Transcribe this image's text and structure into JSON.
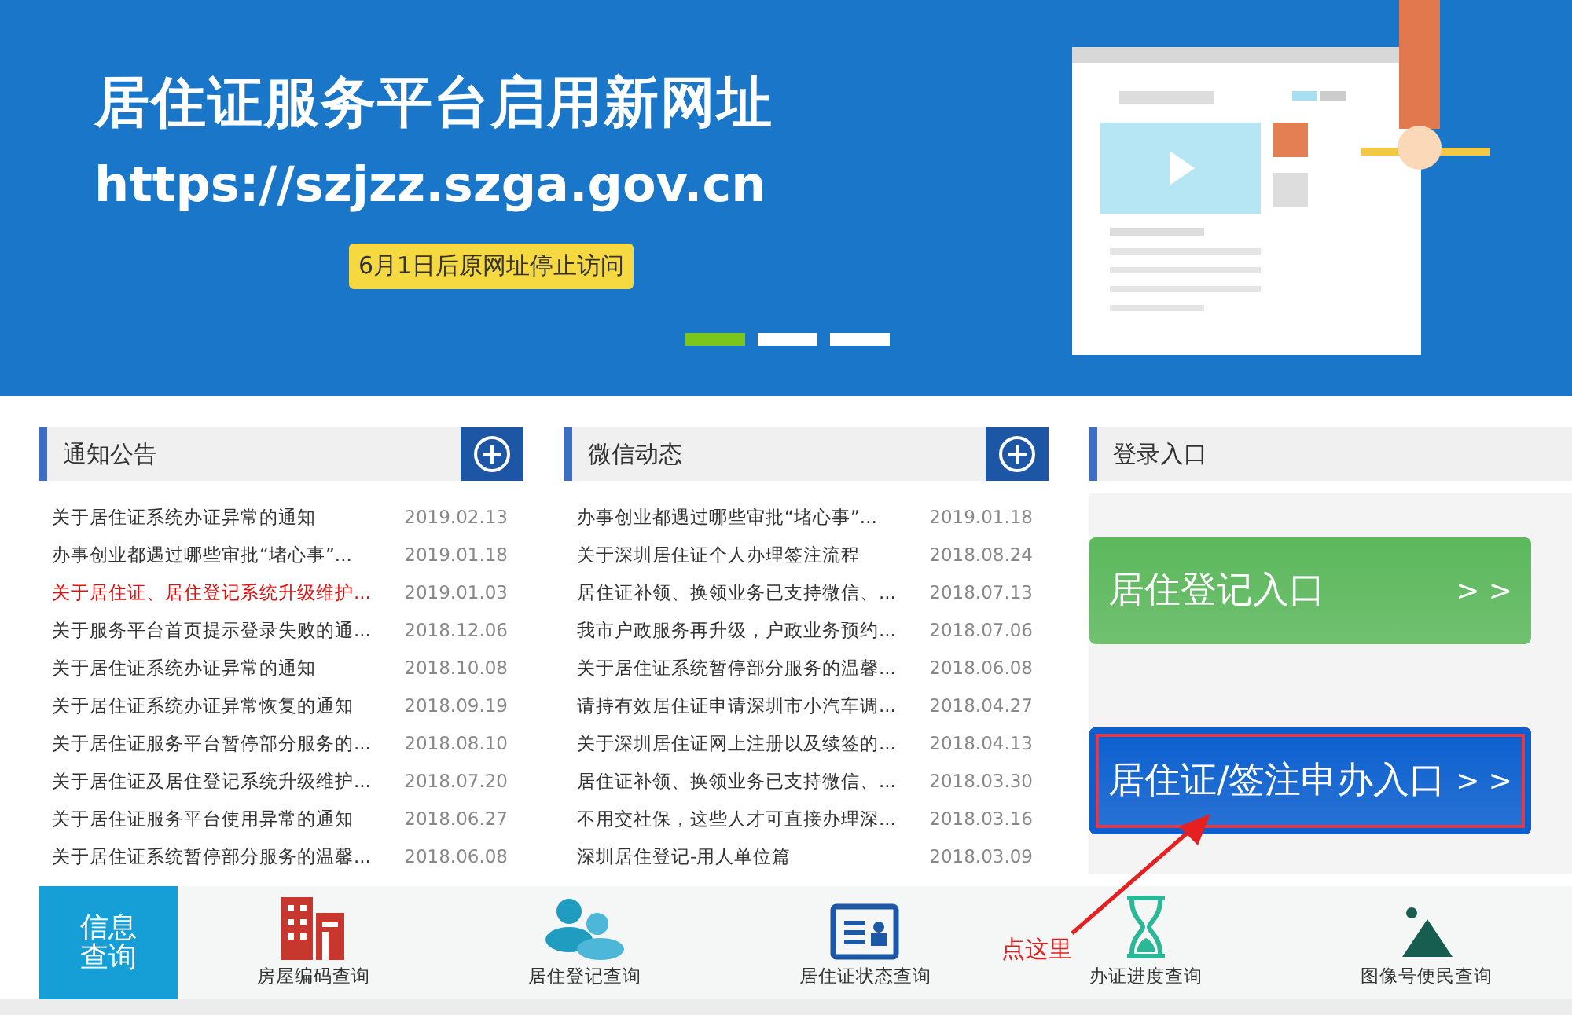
{
  "banner": {
    "headline": "居住证服务平台启用新网址",
    "url": "https://szjzz.szga.gov.cn",
    "notice": "6月1日后原网址停止访问",
    "slides": [
      {
        "selected": true
      },
      {
        "selected": false
      },
      {
        "selected": false
      }
    ]
  },
  "panels": [
    {
      "title": "通知公告",
      "items": [
        {
          "text": "关于居住证系统办证异常的通知",
          "date": "2019.02.13",
          "highlighted": false
        },
        {
          "text": "办事创业都遇过哪些审批“堵心事”...",
          "date": "2019.01.18",
          "highlighted": false
        },
        {
          "text": "关于居住证、居住登记系统升级维护...",
          "date": "2019.01.03",
          "highlighted": true
        },
        {
          "text": "关于服务平台首页提示登录失败的通...",
          "date": "2018.12.06",
          "highlighted": false
        },
        {
          "text": "关于居住证系统办证异常的通知",
          "date": "2018.10.08",
          "highlighted": false
        },
        {
          "text": "关于居住证系统办证异常恢复的通知",
          "date": "2018.09.19",
          "highlighted": false
        },
        {
          "text": "关于居住证服务平台暂停部分服务的...",
          "date": "2018.08.10",
          "highlighted": false
        },
        {
          "text": "关于居住证及居住登记系统升级维护...",
          "date": "2018.07.20",
          "highlighted": false
        },
        {
          "text": "关于居住证服务平台使用异常的通知",
          "date": "2018.06.27",
          "highlighted": false
        },
        {
          "text": "关于居住证系统暂停部分服务的温馨...",
          "date": "2018.06.08",
          "highlighted": false
        }
      ]
    },
    {
      "title": "微信动态",
      "items": [
        {
          "text": "办事创业都遇过哪些审批“堵心事”...",
          "date": "2019.01.18",
          "highlighted": false
        },
        {
          "text": "关于深圳居住证个人办理签注流程",
          "date": "2018.08.24",
          "highlighted": false
        },
        {
          "text": "居住证补领、换领业务已支持微信、...",
          "date": "2018.07.13",
          "highlighted": false
        },
        {
          "text": "我市户政服务再升级，户政业务预约...",
          "date": "2018.07.06",
          "highlighted": false
        },
        {
          "text": "关于居住证系统暂停部分服务的温馨...",
          "date": "2018.06.08",
          "highlighted": false
        },
        {
          "text": "请持有效居住证申请深圳市小汽车调...",
          "date": "2018.04.27",
          "highlighted": false
        },
        {
          "text": "关于深圳居住证网上注册以及续签的...",
          "date": "2018.04.13",
          "highlighted": false
        },
        {
          "text": "居住证补领、换领业务已支持微信、...",
          "date": "2018.03.30",
          "highlighted": false
        },
        {
          "text": "不用交社保，这些人才可直接办理深...",
          "date": "2018.03.16",
          "highlighted": false
        },
        {
          "text": "深圳居住登记-用人单位篇",
          "date": "2018.03.09",
          "highlighted": false
        }
      ]
    }
  ],
  "login": {
    "title": "登录入口",
    "buttons": [
      {
        "label": "居住登记入口",
        "arrow": "> >",
        "color": "#5cb85c",
        "annotated": false
      },
      {
        "label": "居住证/签注申办入口",
        "arrow": "> >",
        "color": "#0b5fcf",
        "annotated": true
      }
    ]
  },
  "query": {
    "title": "信息查询",
    "items": [
      {
        "label": "房屋编码查询",
        "kind": "building"
      },
      {
        "label": "居住登记查询",
        "kind": "people"
      },
      {
        "label": "居住证状态查询",
        "kind": "card"
      },
      {
        "label": "办证进度查询",
        "kind": "hourglass"
      },
      {
        "label": "图像号便民查询",
        "kind": "image"
      }
    ]
  },
  "annotation": {
    "text": "点这里"
  }
}
